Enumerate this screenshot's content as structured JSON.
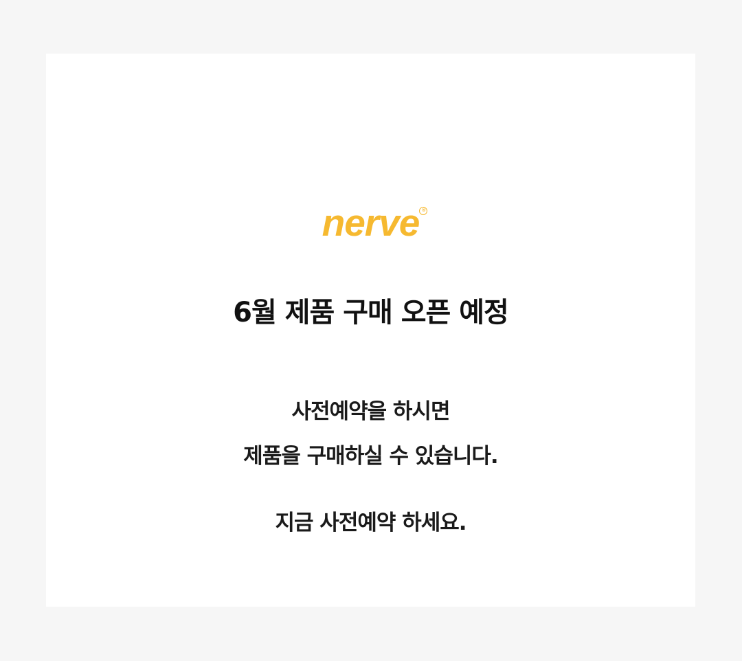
{
  "brand": {
    "logo_text": "nerve",
    "registered_mark": "®",
    "color": "#f6b930"
  },
  "notice": {
    "headline": "6월 제품 구매 오픈 예정",
    "line1": "사전예약을 하시면",
    "line2": "제품을 구매하실 수 있습니다.",
    "line3": "지금 사전예약 하세요."
  },
  "colors": {
    "page_background": "#f6f6f6",
    "card_background": "#ffffff",
    "text": "#111111"
  }
}
